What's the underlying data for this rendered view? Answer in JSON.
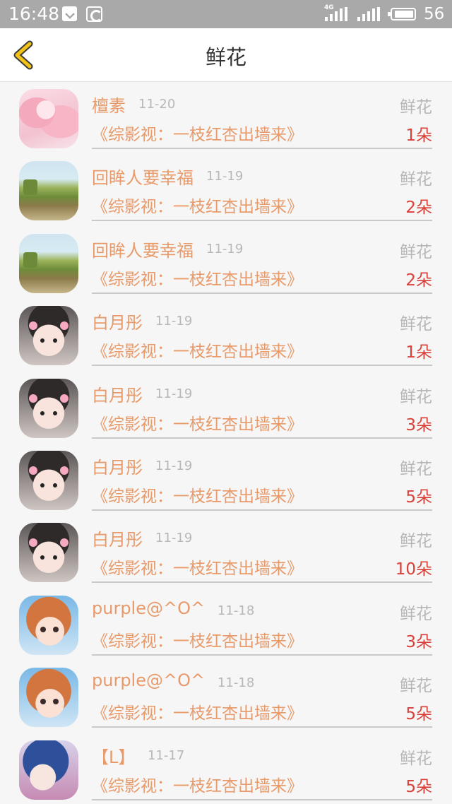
{
  "status_bar": {
    "time": "16:48",
    "network": "4G",
    "battery": "56"
  },
  "header": {
    "title": "鲜花",
    "back_icon": "chevron-left-icon"
  },
  "colors": {
    "accent": "#e89a6a",
    "count": "#d9403a",
    "back": "#f2c218"
  },
  "items": [
    {
      "name": "檀素",
      "date": "11-20",
      "type": "鲜花",
      "book": "《综影视：一枝红杏出墙来》",
      "count": "1朵",
      "avatar": "anime"
    },
    {
      "name": "回眸人要幸福",
      "date": "11-19",
      "type": "鲜花",
      "book": "《综影视：一枝红杏出墙来》",
      "count": "2朵",
      "avatar": "field"
    },
    {
      "name": "回眸人要幸福",
      "date": "11-19",
      "type": "鲜花",
      "book": "《综影视：一枝红杏出墙来》",
      "count": "2朵",
      "avatar": "field"
    },
    {
      "name": "白月彤",
      "date": "11-19",
      "type": "鲜花",
      "book": "《综影视：一枝红杏出墙来》",
      "count": "1朵",
      "avatar": "baby"
    },
    {
      "name": "白月彤",
      "date": "11-19",
      "type": "鲜花",
      "book": "《综影视：一枝红杏出墙来》",
      "count": "3朵",
      "avatar": "baby"
    },
    {
      "name": "白月彤",
      "date": "11-19",
      "type": "鲜花",
      "book": "《综影视：一枝红杏出墙来》",
      "count": "5朵",
      "avatar": "baby"
    },
    {
      "name": "白月彤",
      "date": "11-19",
      "type": "鲜花",
      "book": "《综影视：一枝红杏出墙来》",
      "count": "10朵",
      "avatar": "baby"
    },
    {
      "name": "purple@^O^",
      "date": "11-18",
      "type": "鲜花",
      "book": "《综影视：一枝红杏出墙来》",
      "count": "3朵",
      "avatar": "girl"
    },
    {
      "name": "purple@^O^",
      "date": "11-18",
      "type": "鲜花",
      "book": "《综影视：一枝红杏出墙来》",
      "count": "5朵",
      "avatar": "girl"
    },
    {
      "name": "【L】",
      "date": "11-17",
      "type": "鲜花",
      "book": "《综影视：一枝红杏出墙来》",
      "count": "5朵",
      "avatar": "blue"
    }
  ]
}
